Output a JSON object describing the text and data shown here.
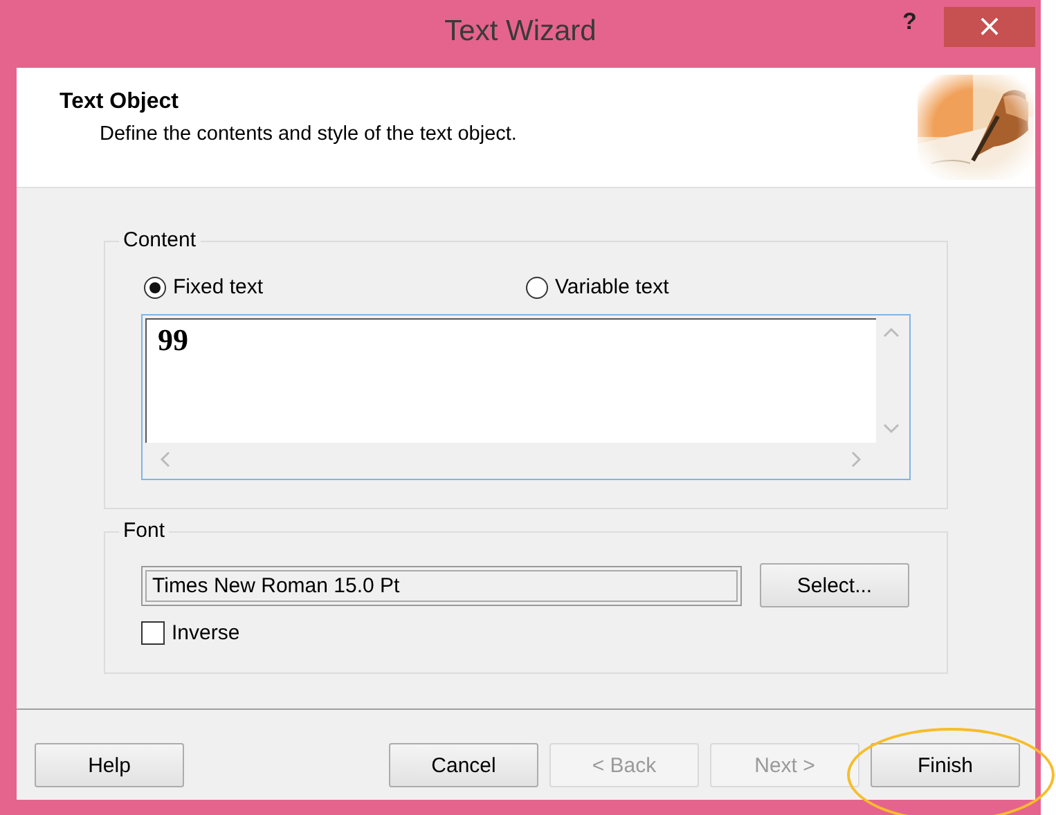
{
  "window": {
    "title": "Text Wizard",
    "help_button": "?",
    "close_button": "×"
  },
  "header": {
    "title": "Text Object",
    "subtitle": "Define the contents and style of the text object."
  },
  "content": {
    "label": "Content",
    "options": [
      {
        "label": "Fixed text",
        "selected": true
      },
      {
        "label": "Variable text",
        "selected": false
      }
    ],
    "text_value": "99"
  },
  "font": {
    "label": "Font",
    "value": "Times New Roman 15.0 Pt",
    "select_button": "Select...",
    "inverse": {
      "label": "Inverse",
      "checked": false
    }
  },
  "buttons": [
    {
      "label": "Help",
      "disabled": false,
      "highlighted": false
    },
    {
      "label": "Cancel",
      "disabled": false,
      "highlighted": false
    },
    {
      "label": "< Back",
      "disabled": true,
      "highlighted": false
    },
    {
      "label": "Next >",
      "disabled": true,
      "highlighted": false
    },
    {
      "label": "Finish",
      "disabled": false,
      "highlighted": true
    }
  ]
}
